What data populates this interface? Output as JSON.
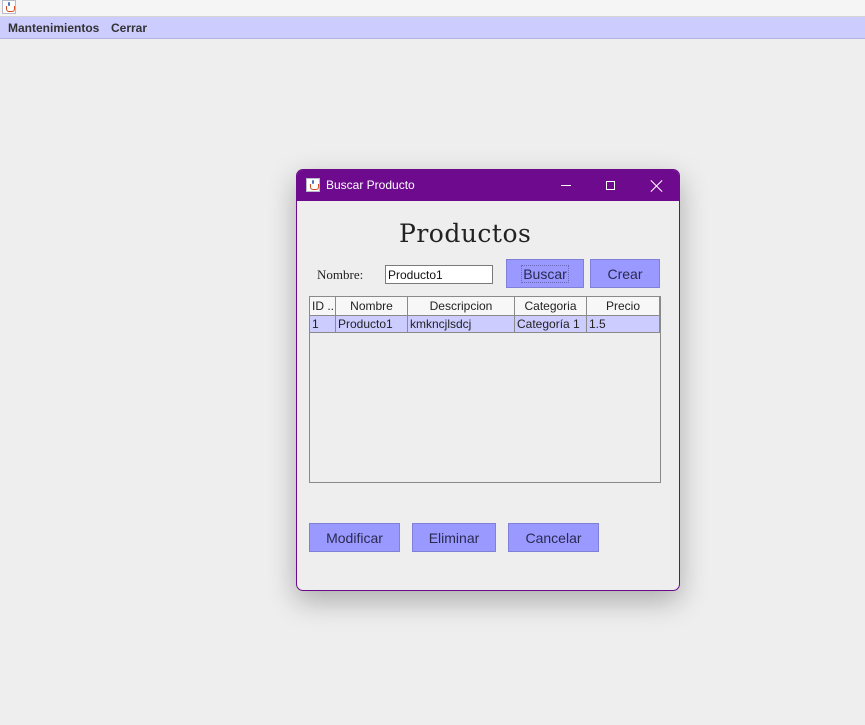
{
  "menubar": {
    "items": [
      "Mantenimientos",
      "Cerrar"
    ]
  },
  "dialog": {
    "title": "Buscar Producto",
    "heading": "Productos",
    "search": {
      "label": "Nombre:",
      "value": "Producto1"
    },
    "buttons": {
      "buscar": "Buscar",
      "crear": "Crear",
      "modificar": "Modificar",
      "eliminar": "Eliminar",
      "cancelar": "Cancelar"
    },
    "table": {
      "columns": [
        "ID ...",
        "Nombre",
        "Descripcion",
        "Categoria",
        "Precio"
      ],
      "rows": [
        [
          "1",
          "Producto1",
          "kmkncjlsdcj",
          "Categoría 1",
          "1.5"
        ]
      ]
    }
  },
  "colors": {
    "titlebar": "#6e0a8e",
    "menubar": "#ccccff",
    "button": "#9999ff",
    "selected_row": "#ccccff"
  }
}
